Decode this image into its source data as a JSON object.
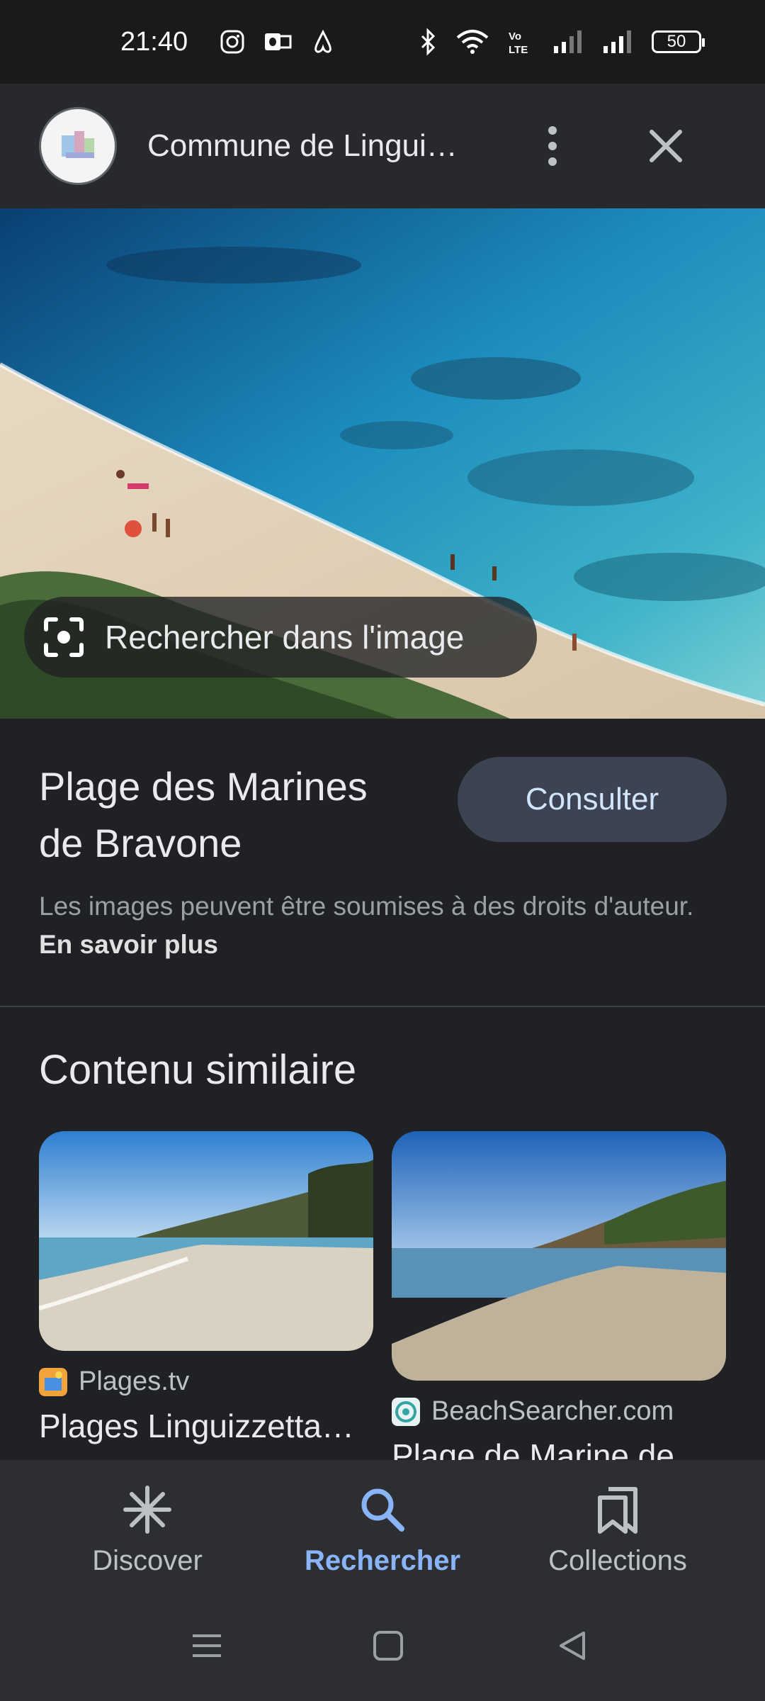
{
  "status_bar": {
    "time": "21:40",
    "battery": "50",
    "left_icons": [
      "instagram-icon",
      "outlook-icon",
      "airbnb-icon"
    ],
    "right_icons": [
      "bluetooth-icon",
      "wifi-icon",
      "volte-icon",
      "signal-icon",
      "signal-icon-2",
      "battery-icon"
    ]
  },
  "header": {
    "title": "Commune de Lingui…",
    "avatar_icon": "site-logo-icon",
    "menu_icon": "more-vert-icon",
    "close_icon": "close-icon"
  },
  "hero": {
    "search_in_image_label": "Rechercher dans l'image",
    "lens_icon": "lens-icon"
  },
  "result": {
    "title_line1": "Plage des Marines",
    "title_line2": "de Bravone",
    "consult_label": "Consulter",
    "copyright_text": "Les images peuvent être soumises à des droits d'auteur.",
    "learn_more": "En savoir plus"
  },
  "similar": {
    "heading": "Contenu similaire",
    "items": [
      {
        "source": "Plages.tv",
        "title": "Plages Linguizzetta…"
      },
      {
        "source": "BeachSearcher.com",
        "title": "Plage de Marine de…"
      }
    ]
  },
  "bottom_nav": {
    "items": [
      {
        "label": "Discover",
        "icon": "asterisk-icon",
        "active": false
      },
      {
        "label": "Rechercher",
        "icon": "search-icon",
        "active": true
      },
      {
        "label": "Collections",
        "icon": "bookmarks-icon",
        "active": false
      }
    ]
  },
  "colors": {
    "background": "#202124",
    "accent": "#8ab4f8",
    "consult_button": "#3c4453"
  }
}
